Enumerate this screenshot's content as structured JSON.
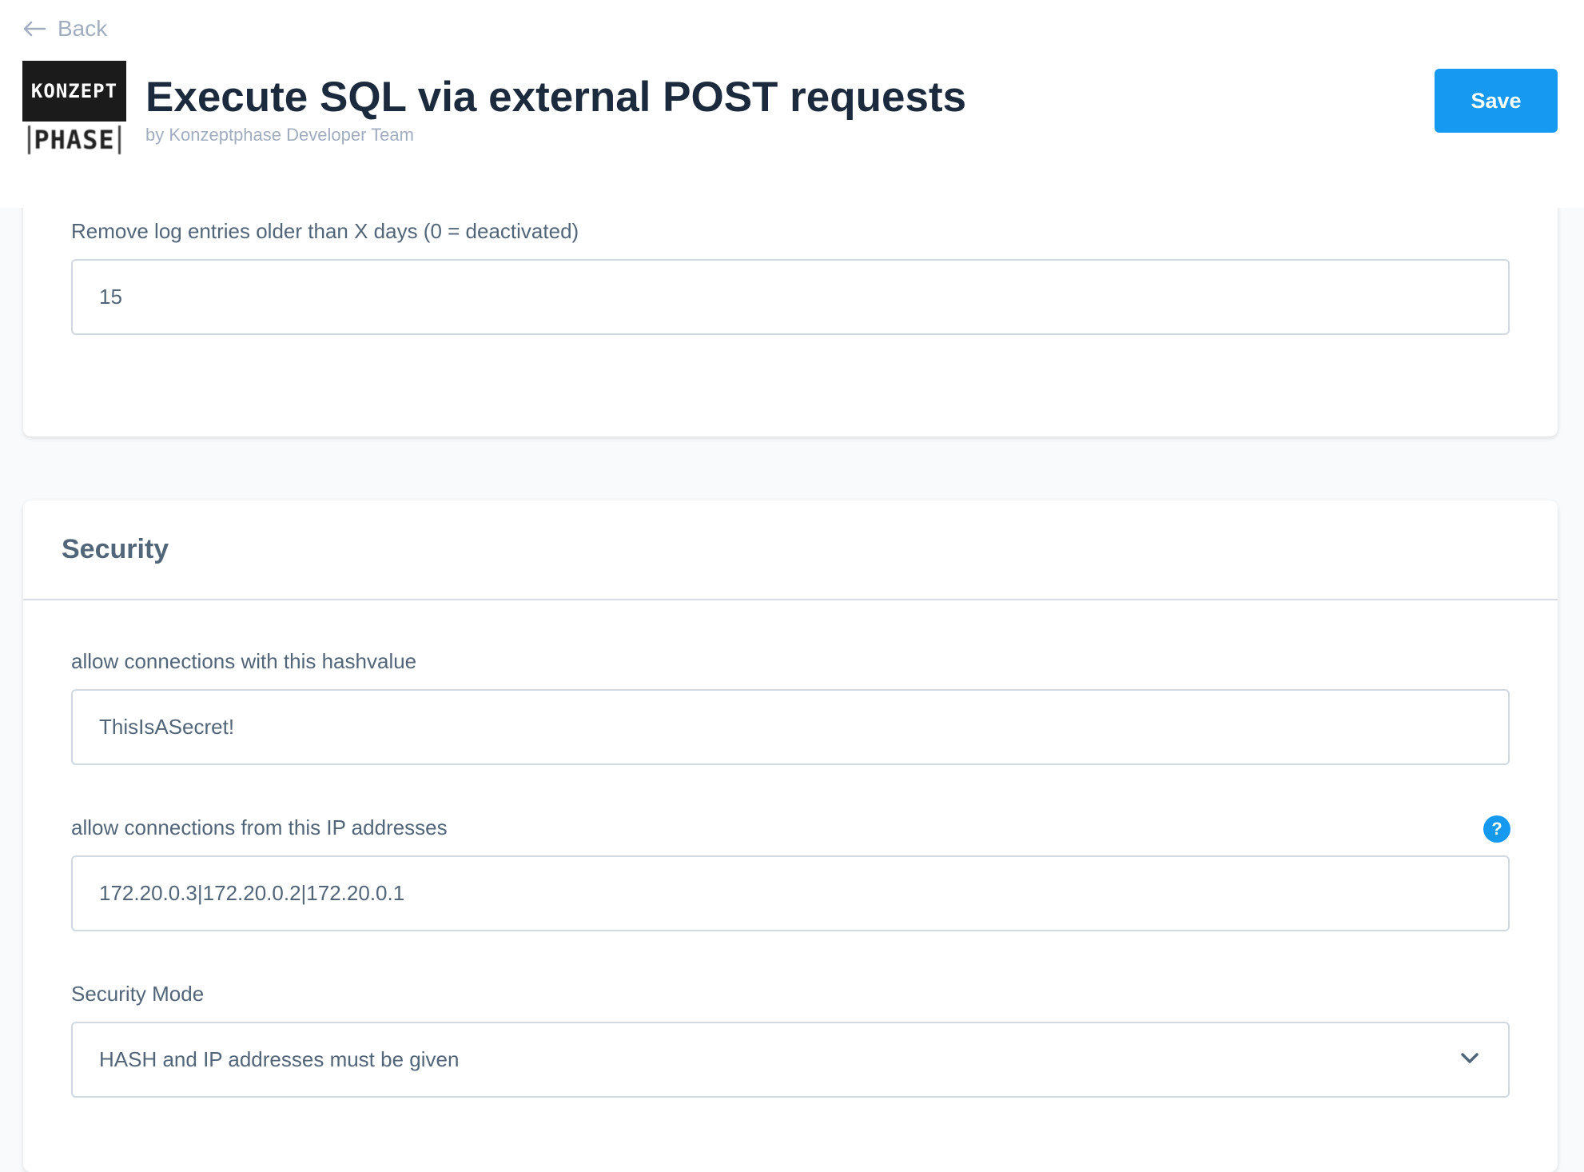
{
  "header": {
    "back_label": "Back",
    "title": "Execute SQL via external POST requests",
    "subtitle": "by Konzeptphase Developer Team",
    "save_label": "Save",
    "logo": {
      "line1": "KONZEPT",
      "line2": "PHASE"
    }
  },
  "log_section": {
    "label": "Remove log entries older than X days (0 = deactivated)",
    "value": "15"
  },
  "security": {
    "heading": "Security",
    "hash_label": "allow connections with this hashvalue",
    "hash_value": "ThisIsASecret!",
    "ip_label": "allow connections from this IP addresses",
    "ip_value": "172.20.0.3|172.20.0.2|172.20.0.1",
    "help_glyph": "?",
    "mode_label": "Security Mode",
    "mode_value": "HASH and IP addresses must be given"
  },
  "icons": {
    "back": "arrow-left-icon",
    "help": "question-circle-icon",
    "dropdown": "chevron-down-icon"
  },
  "colors": {
    "accent": "#1699f0",
    "title": "#1b2b3d",
    "text": "#52667a",
    "muted": "#a0aec0",
    "background": "#f9fafc"
  }
}
